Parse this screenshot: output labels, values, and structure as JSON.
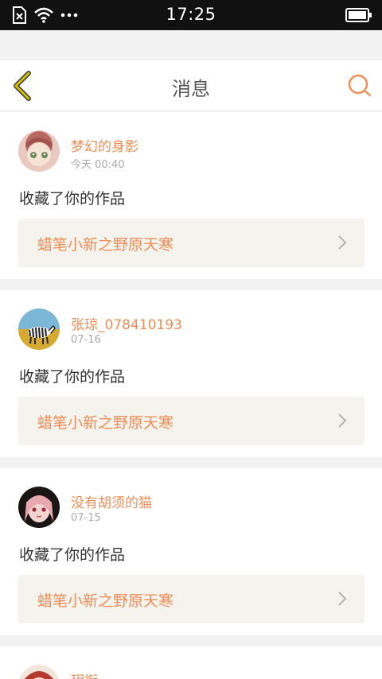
{
  "status": {
    "time": "17:25"
  },
  "nav": {
    "title": "消息"
  },
  "messages": [
    {
      "user": "梦幻的身影",
      "time": "今天 00:40",
      "action": "收藏了你的作品",
      "work": "蜡笔小新之野原天寒"
    },
    {
      "user": "张琼_078410193",
      "time": "07-16",
      "action": "收藏了你的作品",
      "work": "蜡笔小新之野原天寒"
    },
    {
      "user": "没有胡须的猫",
      "time": "07-15",
      "action": "收藏了你的作品",
      "work": "蜡笔小新之野原天寒"
    }
  ],
  "partial": {
    "user": "玥衔"
  },
  "colors": {
    "accent": "#ef8d54",
    "back_icon": "#c8b400",
    "bg": "#f2f2f2"
  },
  "icons": [
    "sim-card-icon",
    "wifi-icon",
    "more-dots-icon",
    "battery-icon",
    "back-arrow-icon",
    "search-icon",
    "chevron-right-icon"
  ]
}
